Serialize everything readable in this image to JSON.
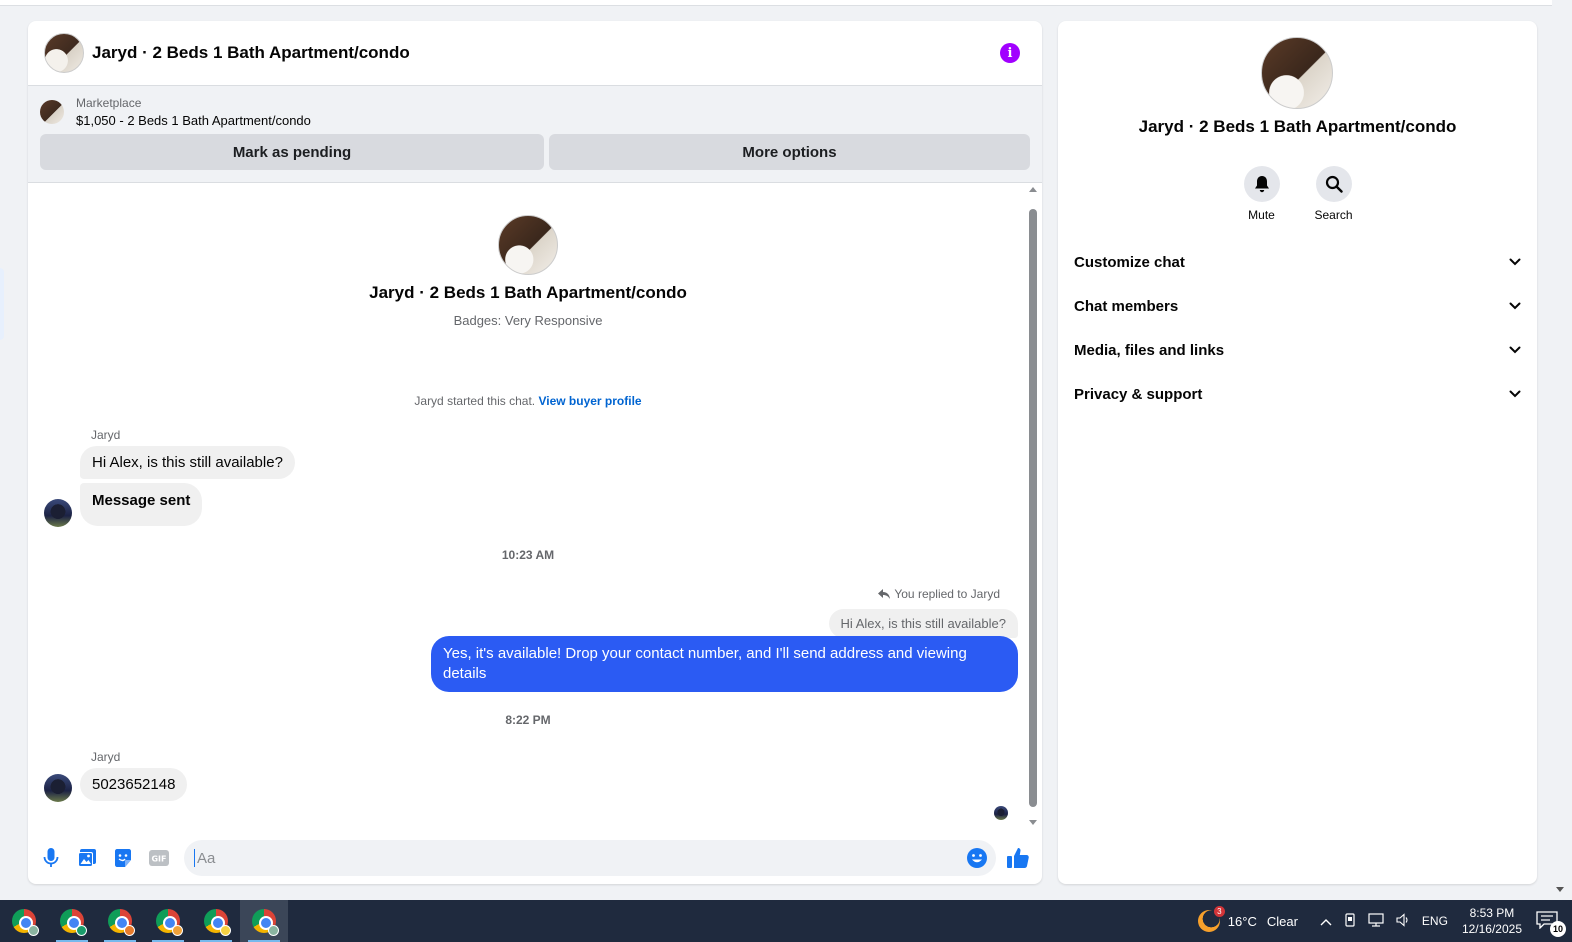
{
  "chat": {
    "title": "Jaryd · 2 Beds 1 Bath Apartment/condo",
    "listing": {
      "source": "Marketplace",
      "price_title": "$1,050 - 2 Beds 1 Bath Apartment/condo",
      "mark_pending_label": "Mark as pending",
      "more_options_label": "More options"
    },
    "profile": {
      "name": "Jaryd · 2 Beds 1 Bath Apartment/condo",
      "badges": "Badges: Very Responsive"
    },
    "system_message": {
      "text": "Jaryd started this chat. ",
      "link": "View buyer profile"
    },
    "messages": {
      "group1_sender": "Jaryd",
      "msg1": "Hi Alex, is this still available?",
      "msg2": "Message sent",
      "time1": "10:23 AM",
      "replied_label": "You replied to Jaryd",
      "replied_quote": "Hi Alex, is this still available?",
      "outgoing": "Yes, it's available! Drop your contact number, and I'll send address and viewing details",
      "time2": "8:22 PM",
      "group2_sender": "Jaryd",
      "msg3": "5023652148"
    },
    "composer": {
      "placeholder": "Aa"
    }
  },
  "sidebar": {
    "name": "Jaryd · 2 Beds 1 Bath Apartment/condo",
    "mute_label": "Mute",
    "search_label": "Search",
    "sections": [
      "Customize chat",
      "Chat members",
      "Media, files and links",
      "Privacy & support"
    ]
  },
  "taskbar": {
    "weather_badge": "3",
    "temperature": "16°C",
    "weather": "Clear",
    "language": "ENG",
    "time": "8:53 PM",
    "date": "12/16/2025",
    "notification_count": "10"
  },
  "colors": {
    "accent": "#2b5bf3",
    "info": "#a100ff",
    "link": "#0064d1",
    "icon_blue": "#1877f2"
  }
}
